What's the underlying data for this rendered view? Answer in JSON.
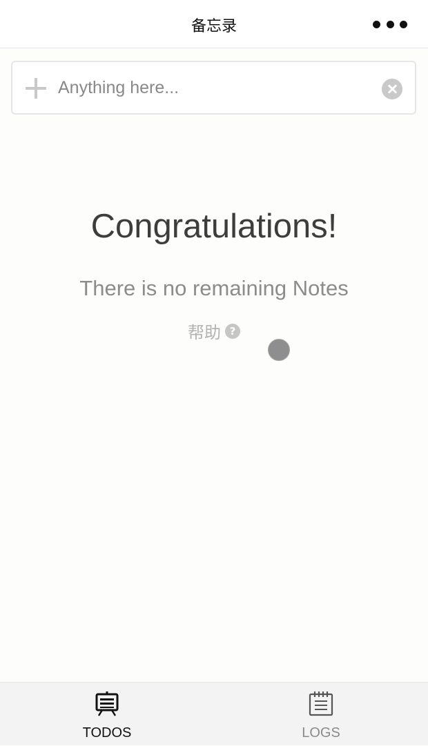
{
  "navbar": {
    "title": "备忘录",
    "more_icon": "more-dots-icon"
  },
  "input": {
    "placeholder": "Anything here...",
    "value": "",
    "add_icon": "plus-icon",
    "clear_icon": "clear-circle-x-icon"
  },
  "empty_state": {
    "title": "Congratulations!",
    "subtitle": "There is no remaining Notes",
    "help_label": "帮助",
    "help_icon": "?"
  },
  "tabbar": {
    "tabs": [
      {
        "label": "TODOS",
        "icon": "todos-board-icon",
        "active": true,
        "color": "#111111"
      },
      {
        "label": "LOGS",
        "icon": "logs-notepad-icon",
        "active": false,
        "color": "#8a8a8a"
      }
    ]
  },
  "colors": {
    "background": "#fdfdfc",
    "navbar": "#ffffff",
    "tabbar": "#f3f3f3",
    "title_text": "#3d3d3d",
    "subtitle_text": "#8c8c8c"
  }
}
